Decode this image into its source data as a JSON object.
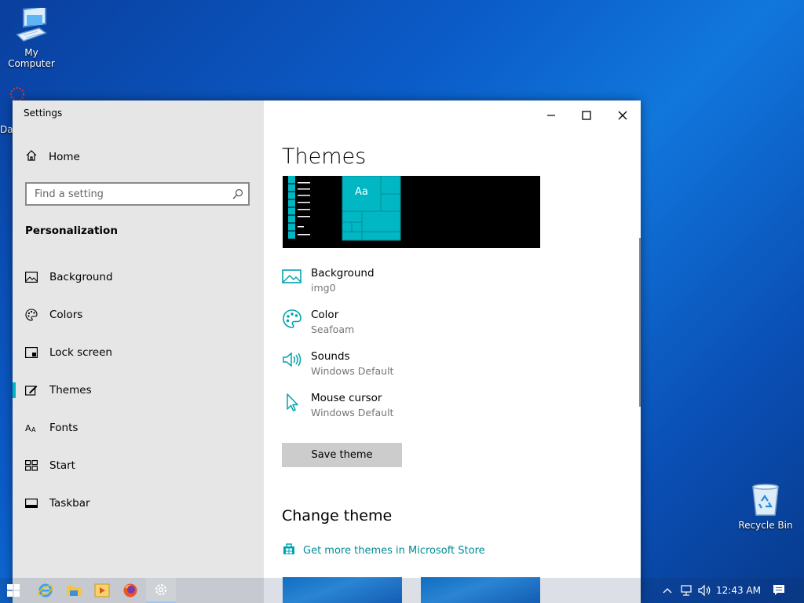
{
  "desktop": {
    "my_computer_label": "My Computer",
    "recycle_bin_label": "Recycle Bin",
    "partial_icon_label": "Da"
  },
  "window": {
    "title": "Settings",
    "controls": [
      "minimize",
      "maximize",
      "close"
    ]
  },
  "sidebar": {
    "home_label": "Home",
    "search_placeholder": "Find a setting",
    "section_title": "Personalization",
    "items": [
      {
        "label": "Background",
        "icon": "picture-icon"
      },
      {
        "label": "Colors",
        "icon": "palette-icon"
      },
      {
        "label": "Lock screen",
        "icon": "lock-screen-icon"
      },
      {
        "label": "Themes",
        "icon": "themes-icon",
        "active": true
      },
      {
        "label": "Fonts",
        "icon": "fonts-icon"
      },
      {
        "label": "Start",
        "icon": "start-icon"
      },
      {
        "label": "Taskbar",
        "icon": "taskbar-icon"
      }
    ]
  },
  "main": {
    "title": "Themes",
    "preview": {
      "tile_text": "Aa",
      "accent": "#00b7c3"
    },
    "properties": [
      {
        "label": "Background",
        "value": "img0",
        "icon": "picture-icon"
      },
      {
        "label": "Color",
        "value": "Seafoam",
        "icon": "palette-icon"
      },
      {
        "label": "Sounds",
        "value": "Windows Default",
        "icon": "speaker-icon"
      },
      {
        "label": "Mouse cursor",
        "value": "Windows Default",
        "icon": "cursor-icon"
      }
    ],
    "save_theme_label": "Save theme",
    "change_theme_title": "Change theme",
    "store_link_label": "Get more themes in Microsoft Store"
  },
  "taskbar": {
    "time": "12:43 AM",
    "apps": [
      "start-icon",
      "internet-explorer-icon",
      "file-explorer-icon",
      "media-player-icon",
      "firefox-icon",
      "settings-icon"
    ]
  },
  "colors": {
    "accent": "#00b7c3",
    "link": "#008b95",
    "sidebar_bg": "#e6e6e6"
  }
}
